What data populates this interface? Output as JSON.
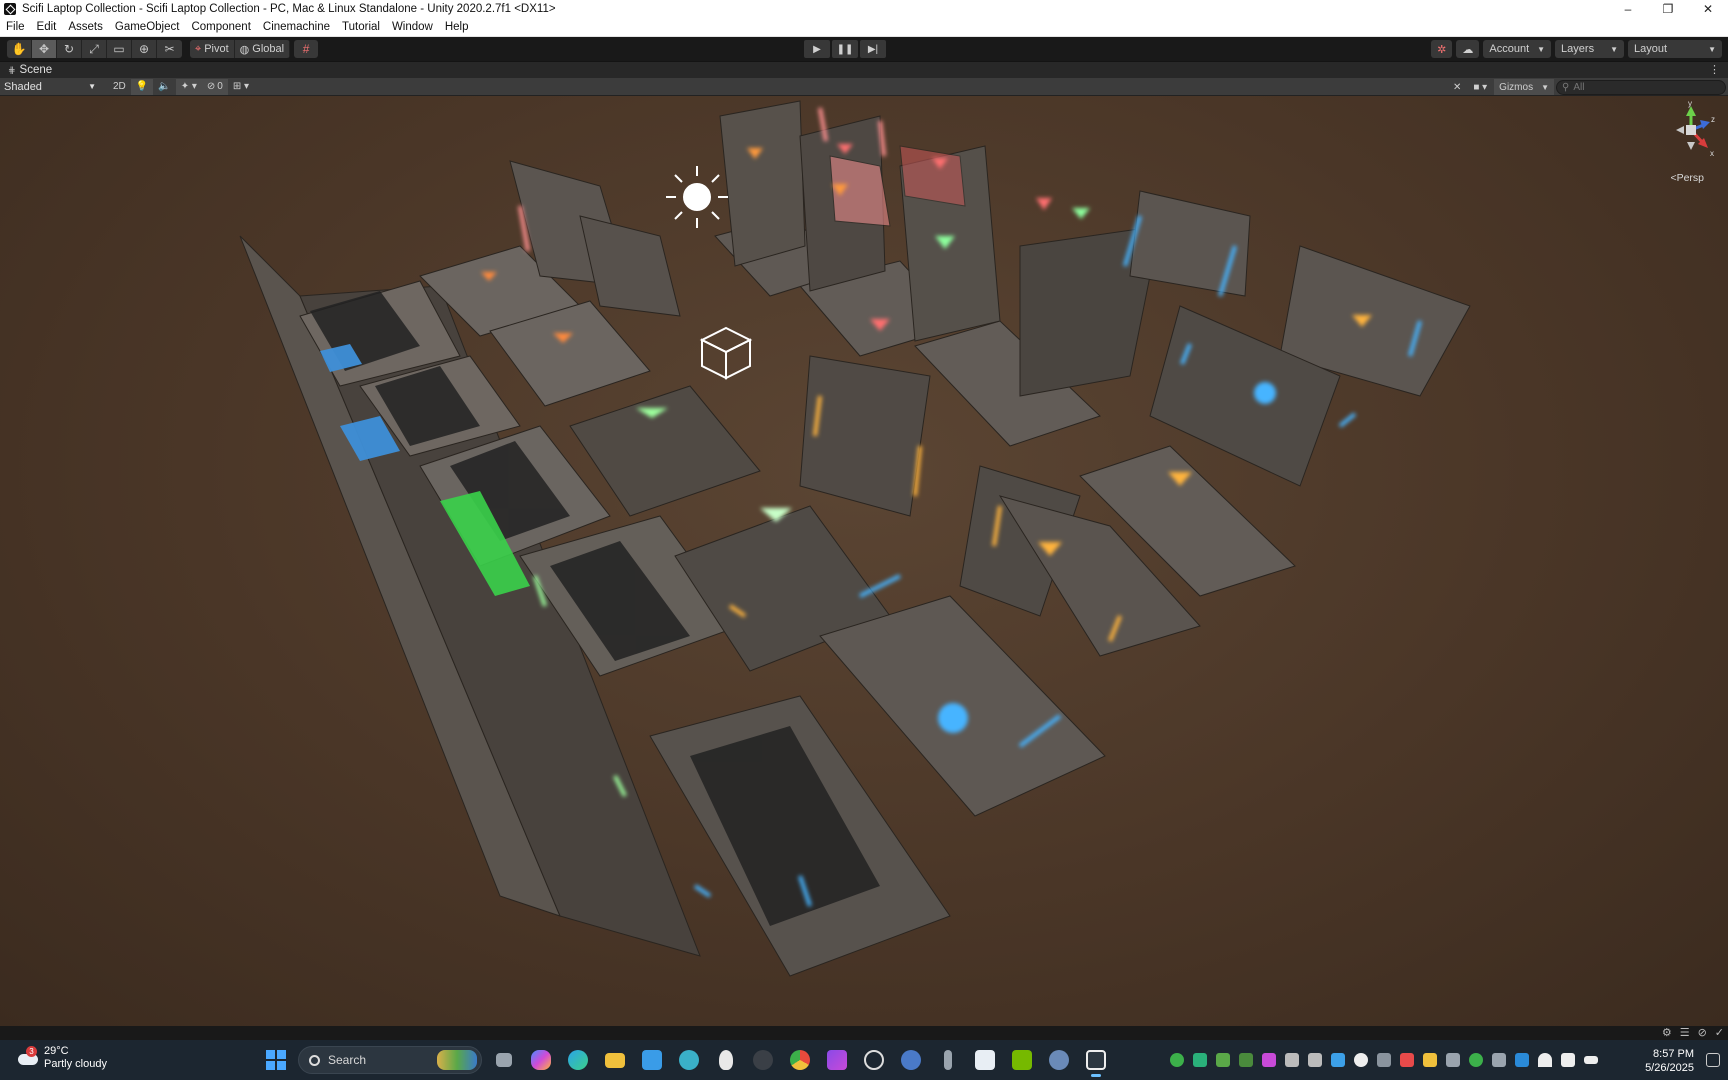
{
  "window": {
    "title": "Scifi Laptop Collection - Scifi Laptop Collection - PC, Mac & Linux Standalone - Unity 2020.2.7f1 <DX11>",
    "controls": [
      "–",
      "❐",
      "✕"
    ]
  },
  "menu": [
    "File",
    "Edit",
    "Assets",
    "GameObject",
    "Component",
    "Cinemachine",
    "Tutorial",
    "Window",
    "Help"
  ],
  "toolbar": {
    "tools": [
      {
        "name": "hand-tool",
        "glyph": "✋"
      },
      {
        "name": "move-tool",
        "glyph": "✥"
      },
      {
        "name": "rotate-tool",
        "glyph": "↻"
      },
      {
        "name": "scale-tool",
        "glyph": "⤢"
      },
      {
        "name": "rect-tool",
        "glyph": "▭"
      },
      {
        "name": "transform-tool",
        "glyph": "⊕"
      },
      {
        "name": "custom-tool",
        "glyph": "✂"
      }
    ],
    "active_tool": 1,
    "pivot_label": "Pivot",
    "global_label": "Global",
    "account_label": "Account",
    "layers_label": "Layers",
    "layout_label": "Layout"
  },
  "scene": {
    "tab_label": "Scene",
    "shading_mode": "Shaded",
    "mode_2d": "2D",
    "hidden_count": "0",
    "gizmos_label": "Gizmos",
    "search_placeholder": "All",
    "projection_label": "<Persp",
    "gizmo_axes": {
      "y": "y",
      "z": "z",
      "x": "x"
    }
  },
  "taskbar": {
    "weather_temp": "29°C",
    "weather_desc": "Partly cloudy",
    "weather_badge": "3",
    "search_label": "Search",
    "time": "8:57 PM",
    "date": "5/26/2025"
  },
  "colors": {
    "accent_red": "#f06464",
    "accent_green": "#7dff8c",
    "accent_blue": "#46b4ff",
    "accent_orange": "#ffb43c",
    "viewport_bg": "#4a3627"
  }
}
